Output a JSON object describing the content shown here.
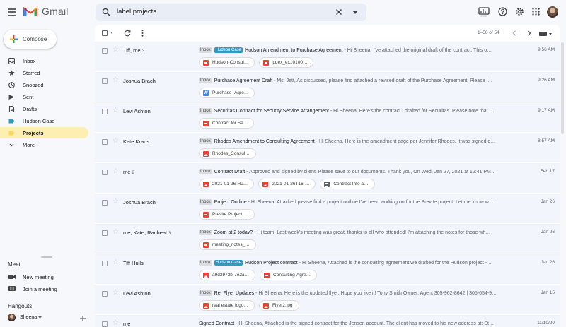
{
  "app": {
    "name": "Gmail"
  },
  "search": {
    "query": "label:projects"
  },
  "compose": {
    "label": "Compose"
  },
  "nav": [
    {
      "label": "Inbox",
      "icon": "inbox-icon"
    },
    {
      "label": "Starred",
      "icon": "star-icon"
    },
    {
      "label": "Snoozed",
      "icon": "clock-icon"
    },
    {
      "label": "Sent",
      "icon": "send-icon"
    },
    {
      "label": "Drafts",
      "icon": "draft-icon"
    },
    {
      "label": "Hudson Case",
      "icon": "label-icon",
      "color": "#2d9cc4"
    },
    {
      "label": "Projects",
      "icon": "label-icon",
      "color": "#fbd75b",
      "active": true
    },
    {
      "label": "More",
      "icon": "chevron-down-icon"
    }
  ],
  "meet": {
    "title": "Meet",
    "items": [
      {
        "label": "New meeting",
        "icon": "video-icon"
      },
      {
        "label": "Join a meeting",
        "icon": "keyboard-icon"
      }
    ]
  },
  "hangouts": {
    "title": "Hangouts",
    "user": "Sheena"
  },
  "toolbar": {
    "pager": "1–50 of 54"
  },
  "colors": {
    "active_label": "#fcefb1",
    "hudson_tag": "#2d9cc4",
    "row_bg": "#f2f6fc"
  },
  "emails": [
    {
      "sender": "Tiff, me",
      "count": "3",
      "tags": [
        "Inbox",
        "Hudson Case"
      ],
      "subject": "Hudson Amendment to Purchase Agreement",
      "snippet": " - Hi Sheena, I've attached the original draft of the contract. This o…",
      "date": "9:56 AM",
      "attachments": [
        {
          "name": "Hudson-Consul…",
          "type": "pdf"
        },
        {
          "name": "pdex_ex10100…",
          "type": "pdf"
        }
      ]
    },
    {
      "sender": "Joshua Brach",
      "count": "",
      "tags": [
        "Inbox"
      ],
      "subject": "Purchase Agreement Draft",
      "snippet": " - Ms. Jett, As discussed, please find attached a revised draft of the Purchase Agreement. Please l…",
      "date": "9:26 AM",
      "attachments": [
        {
          "name": "Purchase_Agre…",
          "type": "doc"
        }
      ]
    },
    {
      "sender": "Levi Ashton",
      "count": "",
      "tags": [
        "Inbox"
      ],
      "subject": "Securitas Contract for Security Service Arrangement",
      "snippet": " - Hi Sheena, Here's the contract I drafted for Securitas. Please note that …",
      "date": "9:17 AM",
      "attachments": [
        {
          "name": "Contract for Se…",
          "type": "pdf"
        }
      ]
    },
    {
      "sender": "Kate Krans",
      "count": "",
      "tags": [
        "Inbox"
      ],
      "subject": "Rhodes Amendment to Consulting Agreement",
      "snippet": " - Hi Sheena, Here is the amendment page per Jennifer Rhodes. It was signed o…",
      "date": "8:57 AM",
      "attachments": [
        {
          "name": "Rhodes_Consul…",
          "type": "img"
        }
      ]
    },
    {
      "sender": "me",
      "count": "2",
      "tags": [
        "Inbox"
      ],
      "subject": "Contract Draft",
      "snippet": " - Approved and signed by client. Please save to our documents. Thank you, On Wed, Jan 27, 2021 at 12:41 PM…",
      "date": "Feb 17",
      "attachments": [
        {
          "name": "2021-01-26-Hu…",
          "type": "img"
        },
        {
          "name": "2021-01-26T16-…",
          "type": "img"
        },
        {
          "name": "Contract Info a…",
          "type": "txt"
        }
      ]
    },
    {
      "sender": "Joshua Brach",
      "count": "",
      "tags": [
        "Inbox"
      ],
      "subject": "Project Outline",
      "snippet": " - Hi Sheena, Attached please find a project outline I've been working on for the Previte project. Let me know w…",
      "date": "Jan 26",
      "attachments": [
        {
          "name": "Previte Project …",
          "type": "pdf"
        }
      ]
    },
    {
      "sender": "me, Kate, Racheal",
      "count": "3",
      "tags": [
        "Inbox"
      ],
      "subject": "Zoom at 2 today?",
      "snippet": " - Hi team! Last week's meeting was great, thanks to all who attended! I'm attaching the notes for those wh…",
      "date": "Jan 26",
      "attachments": [
        {
          "name": "meeting_notes_…",
          "type": "pdf"
        }
      ]
    },
    {
      "sender": "Tiff Hulls",
      "count": "",
      "tags": [
        "Inbox",
        "Hudson Case"
      ],
      "subject": "Hudson Project contract",
      "snippet": " - Hi Sheena, Attached is the consulting agreement we drafted for the Hudson project - …",
      "date": "Jan 26",
      "attachments": [
        {
          "name": "a9d2973b-7e2a…",
          "type": "img"
        },
        {
          "name": "Consulting-Agre…",
          "type": "pdf"
        }
      ]
    },
    {
      "sender": "Levi Ashton",
      "count": "",
      "tags": [
        "Inbox"
      ],
      "subject": "Re: Flyer Updates",
      "snippet": " - Hi Sheena, Here is the updated flyer. Hope you like it! Tony Smith Owner, Agent 305-962-8642 | 305-654-9…",
      "date": "Jan 15",
      "attachments": [
        {
          "name": "real estate logo…",
          "type": "img"
        },
        {
          "name": "Flyer2.jpg",
          "type": "img"
        }
      ]
    },
    {
      "sender": "me",
      "count": "",
      "tags": [],
      "subject": "Signed Contract",
      "snippet": " - Hi Sheena, Attached is the signed contract for the Jensen account. The client has moved to his new address at: St…",
      "date": "11/10/20",
      "attachments": []
    }
  ]
}
